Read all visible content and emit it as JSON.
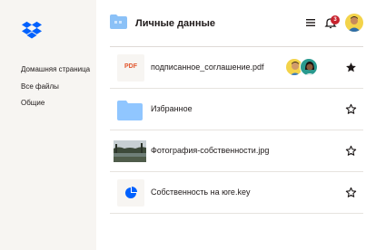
{
  "sidebar": {
    "items": [
      {
        "label": "Домашняя страница"
      },
      {
        "label": "Все файлы"
      },
      {
        "label": "Общие"
      }
    ]
  },
  "header": {
    "title": "Личные данные",
    "notifications_count": "3"
  },
  "files": [
    {
      "name": "подписанное_соглашение.pdf",
      "thumb_label": "PDF",
      "starred": true
    },
    {
      "name": "Избранное",
      "starred": false
    },
    {
      "name": "Фотография-собственности.jpg",
      "starred": false
    },
    {
      "name": "Собственность на юге.key",
      "starred": false
    }
  ],
  "colors": {
    "brand": "#0061fe",
    "folder": "#90c6ff",
    "sidebar_bg": "#f7f5f2",
    "badge": "#c8242f",
    "pdf": "#e2552c"
  }
}
